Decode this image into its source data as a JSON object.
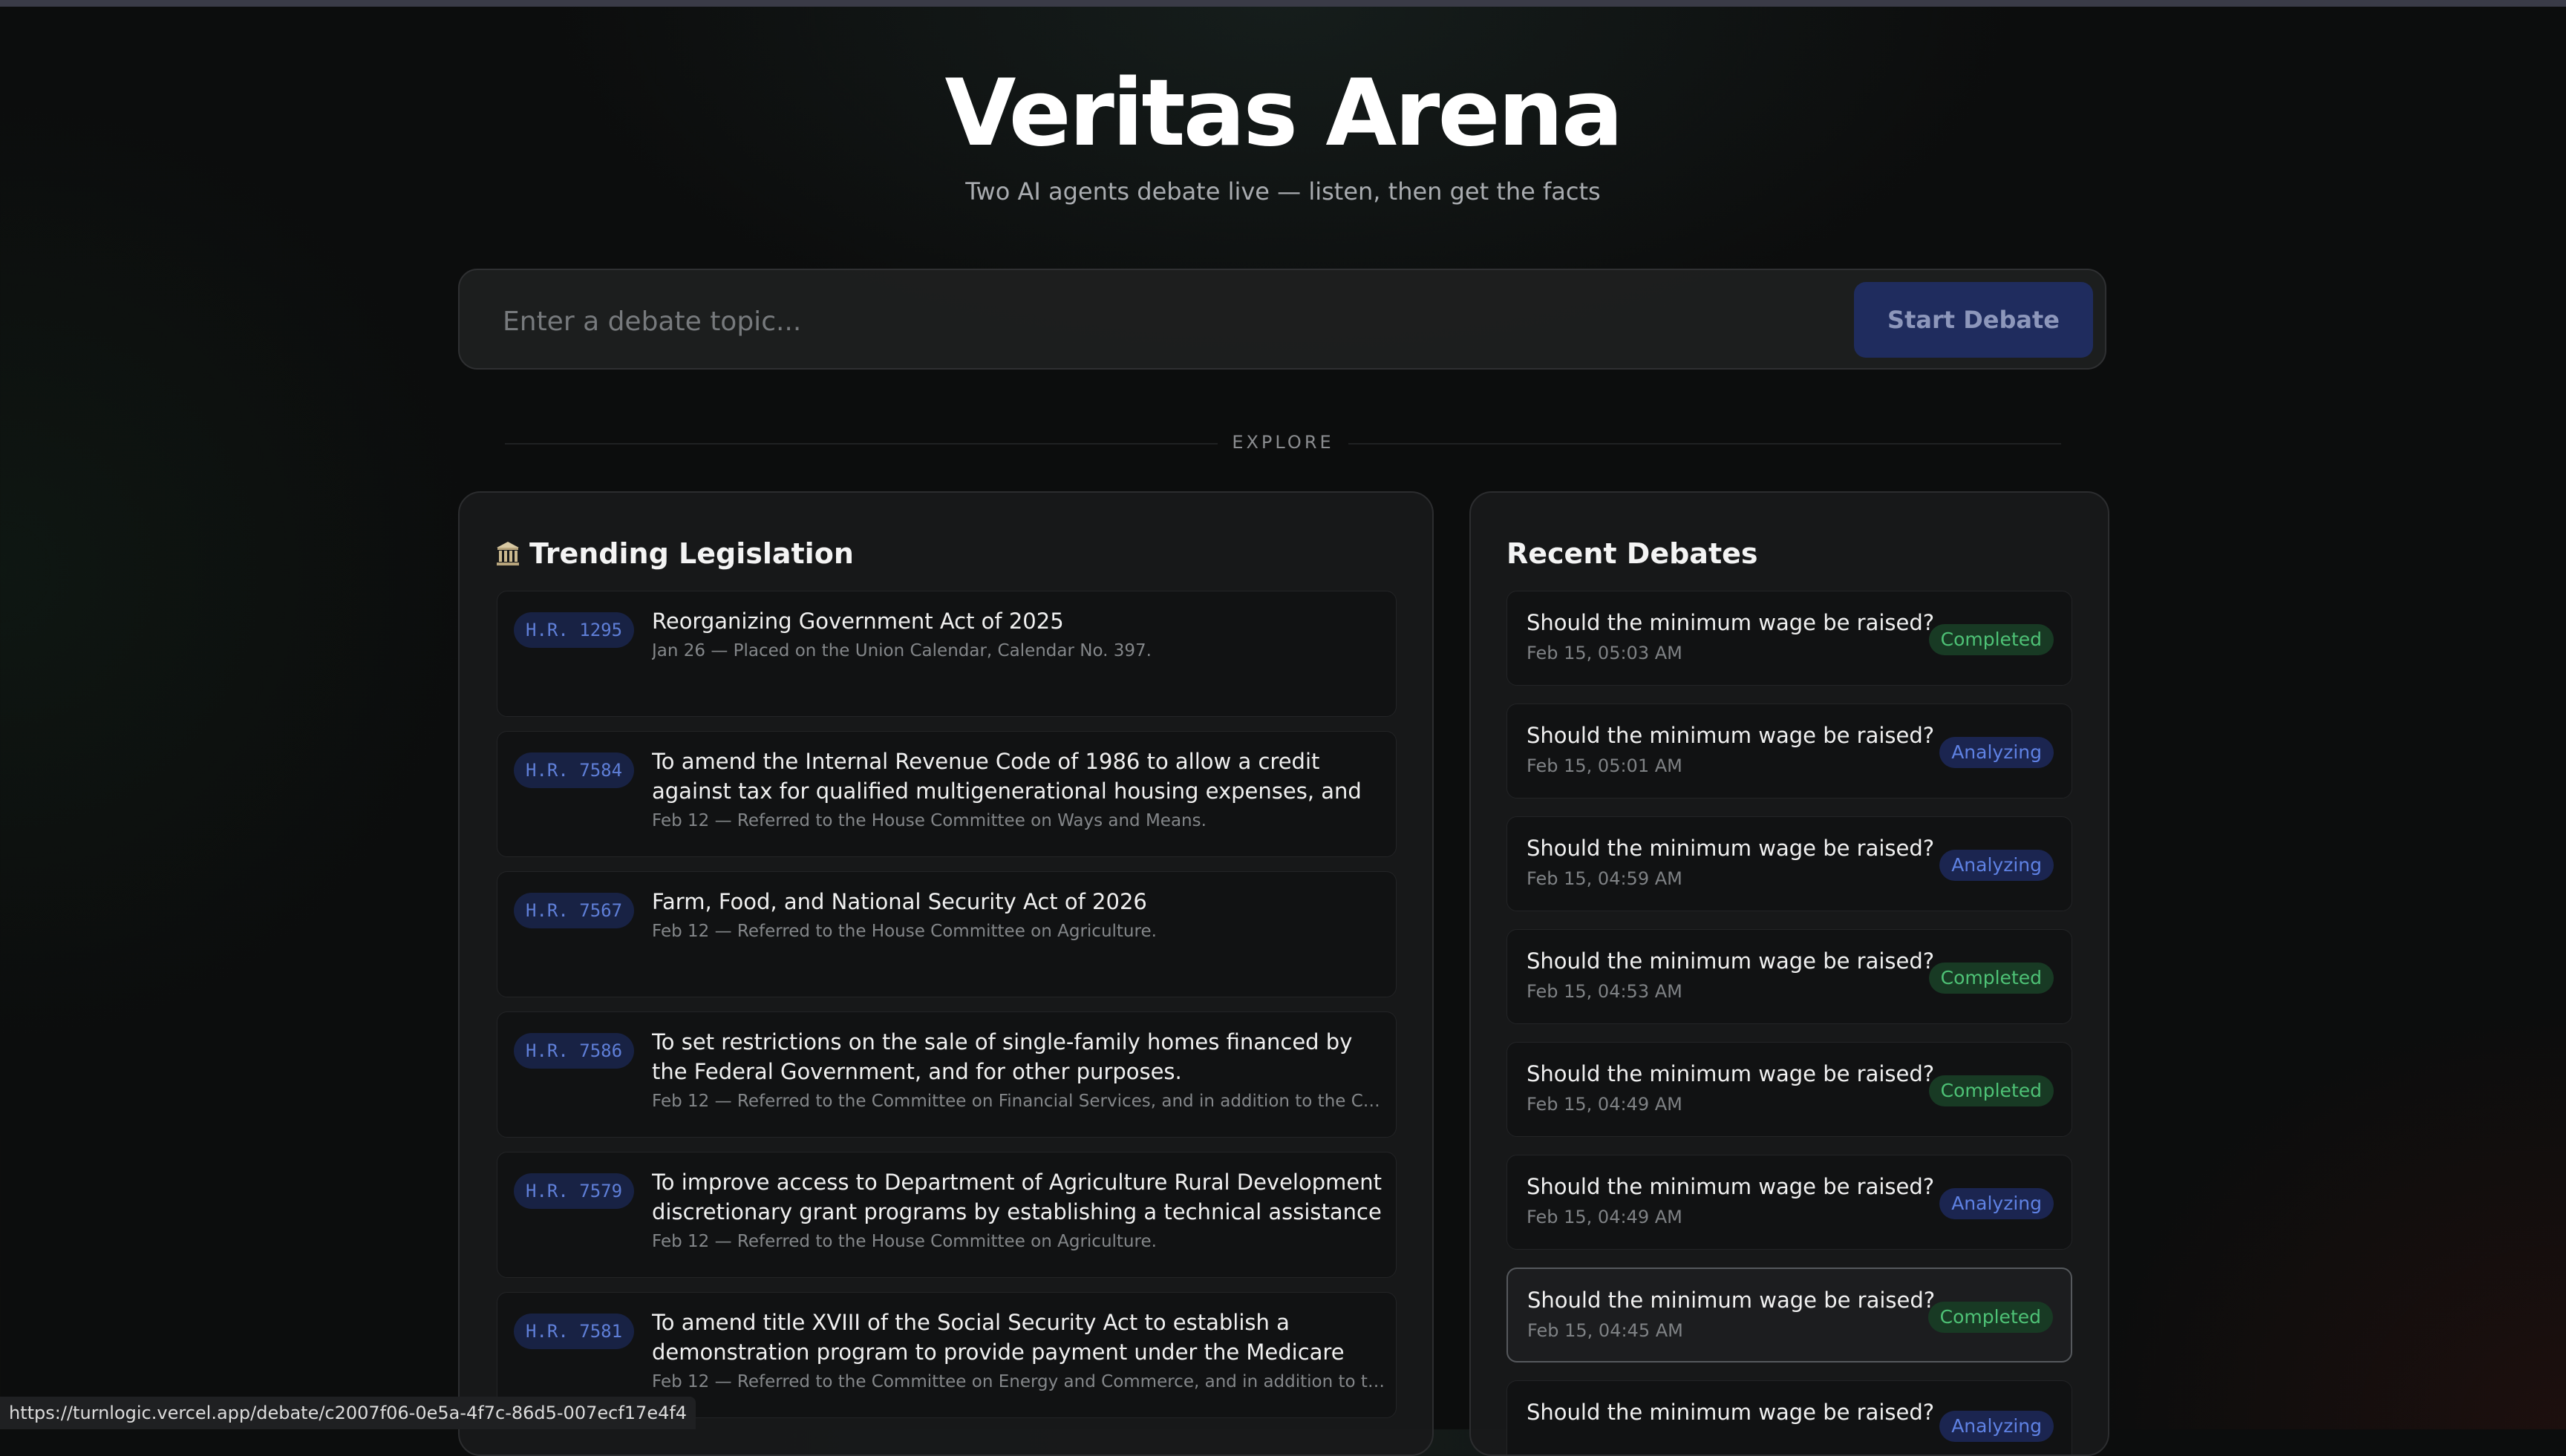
{
  "header": {
    "title": "Veritas Arena",
    "subtitle": "Two AI agents debate live — listen, then get the facts"
  },
  "search": {
    "placeholder": "Enter a debate topic...",
    "button_label": "Start Debate"
  },
  "explore_label": "EXPLORE",
  "legislation": {
    "title": "Trending Legislation",
    "icon": "bank-building-icon",
    "items": [
      {
        "bill": "H.R. 1295",
        "title": "Reorganizing Government Act of 2025",
        "meta": "Jan 26 — Placed on the Union Calendar, Calendar No. 397."
      },
      {
        "bill": "H.R. 7584",
        "title": "To amend the Internal Revenue Code of 1986 to allow a credit against tax for qualified multigenerational housing expenses, and for other purposes.",
        "meta": "Feb 12 — Referred to the House Committee on Ways and Means."
      },
      {
        "bill": "H.R. 7567",
        "title": "Farm, Food, and National Security Act of 2026",
        "meta": "Feb 12 — Referred to the House Committee on Agriculture."
      },
      {
        "bill": "H.R. 7586",
        "title": "To set restrictions on the sale of single-family homes financed by the Federal Government, and for other purposes.",
        "meta": "Feb 12 — Referred to the Committee on Financial Services, and in addition to the Co..."
      },
      {
        "bill": "H.R. 7579",
        "title": "To improve access to Department of Agriculture Rural Development discretionary grant programs by establishing a technical assistance set-...",
        "meta": "Feb 12 — Referred to the House Committee on Agriculture."
      },
      {
        "bill": "H.R. 7581",
        "title": "To amend title XVIII of the Social Security Act to establish a demonstration program to provide payment under the Medicare progra...",
        "meta": "Feb 12 — Referred to the Committee on Energy and Commerce, and in addition to th..."
      }
    ]
  },
  "debates": {
    "title": "Recent Debates",
    "items": [
      {
        "topic": "Should the minimum wage be raised?",
        "time": "Feb 15, 05:03 AM",
        "status": "Completed"
      },
      {
        "topic": "Should the minimum wage be raised?",
        "time": "Feb 15, 05:01 AM",
        "status": "Analyzing"
      },
      {
        "topic": "Should the minimum wage be raised?",
        "time": "Feb 15, 04:59 AM",
        "status": "Analyzing"
      },
      {
        "topic": "Should the minimum wage be raised?",
        "time": "Feb 15, 04:53 AM",
        "status": "Completed"
      },
      {
        "topic": "Should the minimum wage be raised?",
        "time": "Feb 15, 04:49 AM",
        "status": "Completed"
      },
      {
        "topic": "Should the minimum wage be raised?",
        "time": "Feb 15, 04:49 AM",
        "status": "Analyzing"
      },
      {
        "topic": "Should the minimum wage be raised?",
        "time": "Feb 15, 04:45 AM",
        "status": "Completed"
      },
      {
        "topic": "Should the minimum wage be raised?",
        "time": "",
        "status": "Analyzing"
      }
    ]
  },
  "status_bar_url": "https://turnlogic.vercel.app/debate/c2007f06-0e5a-4f7c-86d5-007ecf17e4f4",
  "colors": {
    "background": "#0c0d0d",
    "card": "#18191a",
    "accent_button": "#1f2c5e",
    "badge_bill": "#182244",
    "completed": "#4ec276",
    "analyzing": "#5f82e4"
  }
}
